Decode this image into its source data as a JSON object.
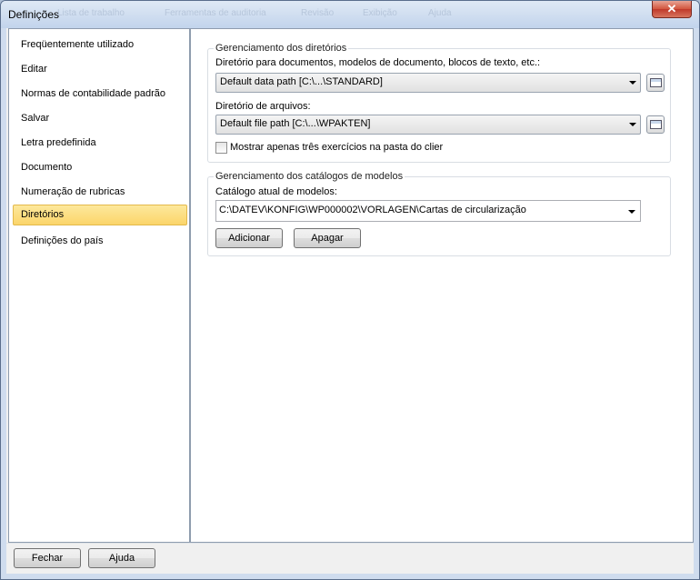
{
  "window": {
    "title": "Definições",
    "ghost_menu": [
      "Lista de trabalho",
      "Ferramentas de auditoria",
      "Revisão",
      "Exibição",
      "Ajuda"
    ],
    "close_glyph": "✕"
  },
  "nav": {
    "items": [
      {
        "label": "Freqüentemente utilizado",
        "selected": false
      },
      {
        "label": "Editar",
        "selected": false
      },
      {
        "label": "Normas de contabilidade padrão",
        "selected": false
      },
      {
        "label": "Salvar",
        "selected": false
      },
      {
        "label": "Letra predefinida",
        "selected": false
      },
      {
        "label": "Documento",
        "selected": false
      },
      {
        "label": "Numeração de rubricas",
        "selected": false
      },
      {
        "label": "Diretórios",
        "selected": true
      },
      {
        "label": "Definições do país",
        "selected": false
      }
    ]
  },
  "directories": {
    "group_title": "Gerenciamento dos diretórios",
    "doc_label": "Diretório para documentos, modelos de documento, blocos de texto, etc.:",
    "doc_value": "Default data path [C:\\...\\STANDARD]",
    "files_label": "Diretório de arquivos:",
    "files_value": "Default file path [C:\\...\\WPAKTEN]",
    "checkbox_label": "Mostrar apenas três exercícios na pasta do clier",
    "checkbox_checked": false
  },
  "catalogs": {
    "group_title": "Gerenciamento dos catálogos de modelos",
    "current_label": "Catálogo atual de modelos:",
    "current_value": "C:\\DATEV\\KONFIG\\WP000002\\VORLAGEN\\Cartas de circularização",
    "add_label": "Adicionar",
    "delete_label": "Apagar"
  },
  "footer": {
    "close_label": "Fechar",
    "help_label": "Ajuda"
  },
  "colors": {
    "selection": "#fbd56a",
    "close_button": "#c0392b"
  }
}
